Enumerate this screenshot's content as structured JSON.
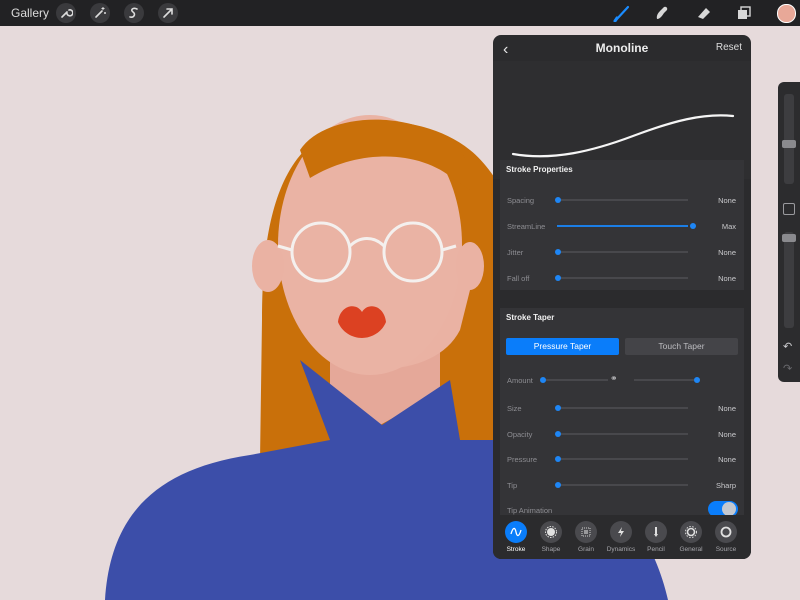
{
  "topbar": {
    "gallery_label": "Gallery"
  },
  "panel": {
    "title": "Monoline",
    "reset_label": "Reset",
    "stroke_properties": {
      "title": "Stroke Properties",
      "rows": [
        {
          "label": "Spacing",
          "value": "None",
          "level": 0
        },
        {
          "label": "StreamLine",
          "value": "Max",
          "level": 1
        },
        {
          "label": "Jitter",
          "value": "None",
          "level": 0
        },
        {
          "label": "Fall off",
          "value": "None",
          "level": 0
        }
      ]
    },
    "stroke_taper": {
      "title": "Stroke Taper",
      "pressure_taper_label": "Pressure Taper",
      "touch_taper_label": "Touch Taper",
      "amount_label": "Amount",
      "rows": [
        {
          "label": "Size",
          "value": "None",
          "level": 0
        },
        {
          "label": "Opacity",
          "value": "None",
          "level": 0
        },
        {
          "label": "Pressure",
          "value": "None",
          "level": 0
        },
        {
          "label": "Tip",
          "value": "Sharp",
          "level": 0
        }
      ],
      "tip_animation_label": "Tip Animation",
      "tip_animation_on": true
    },
    "tabs": [
      {
        "label": "Stroke",
        "icon": "stroke-icon",
        "active": true
      },
      {
        "label": "Shape",
        "icon": "shape-icon",
        "active": false
      },
      {
        "label": "Grain",
        "icon": "grain-icon",
        "active": false
      },
      {
        "label": "Dynamics",
        "icon": "dynamics-icon",
        "active": false
      },
      {
        "label": "Pencil",
        "icon": "pencil-icon",
        "active": false
      },
      {
        "label": "General",
        "icon": "general-icon",
        "active": false
      },
      {
        "label": "Source",
        "icon": "source-icon",
        "active": false
      }
    ]
  },
  "colors": {
    "accent": "#0a7dfa",
    "current_color": "#e8a898",
    "canvas": "#e6dadb"
  }
}
